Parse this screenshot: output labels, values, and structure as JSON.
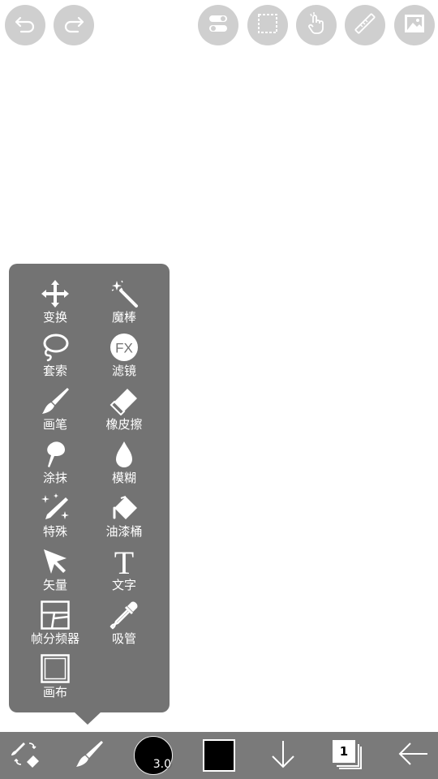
{
  "topbar": {
    "undo_icon": "undo-icon",
    "redo_icon": "redo-icon",
    "toggle_icon": "toggle-settings-icon",
    "selection_icon": "selection-icon",
    "gesture_icon": "hand-gesture-icon",
    "ruler_icon": "ruler-icon",
    "image_icon": "image-icon"
  },
  "tool_menu": {
    "items": [
      {
        "label": "变换",
        "icon": "move-arrows-icon"
      },
      {
        "label": "魔棒",
        "icon": "magic-wand-icon"
      },
      {
        "label": "套索",
        "icon": "lasso-icon"
      },
      {
        "label": "滤镜",
        "icon": "fx-filter-icon",
        "icon_text": "FX"
      },
      {
        "label": "画笔",
        "icon": "brush-icon"
      },
      {
        "label": "橡皮擦",
        "icon": "eraser-icon"
      },
      {
        "label": "涂抹",
        "icon": "smudge-icon"
      },
      {
        "label": "模糊",
        "icon": "blur-drop-icon"
      },
      {
        "label": "特殊",
        "icon": "special-sparkle-pen-icon"
      },
      {
        "label": "油漆桶",
        "icon": "paint-bucket-icon"
      },
      {
        "label": "矢量",
        "icon": "cursor-arrow-icon"
      },
      {
        "label": "文字",
        "icon": "text-icon",
        "icon_text": "T"
      },
      {
        "label": "帧分频器",
        "icon": "frame-divider-icon"
      },
      {
        "label": "吸管",
        "icon": "eyedropper-icon"
      },
      {
        "label": "画布",
        "icon": "canvas-icon"
      }
    ]
  },
  "bottom_bar": {
    "brush_size": "3.0",
    "layer_count": "1",
    "color": "#000000"
  },
  "colors": {
    "menu_bg": "#737373",
    "bottom_bar_bg": "#7a7a7a",
    "top_button_bg": "#cfcfcf"
  }
}
